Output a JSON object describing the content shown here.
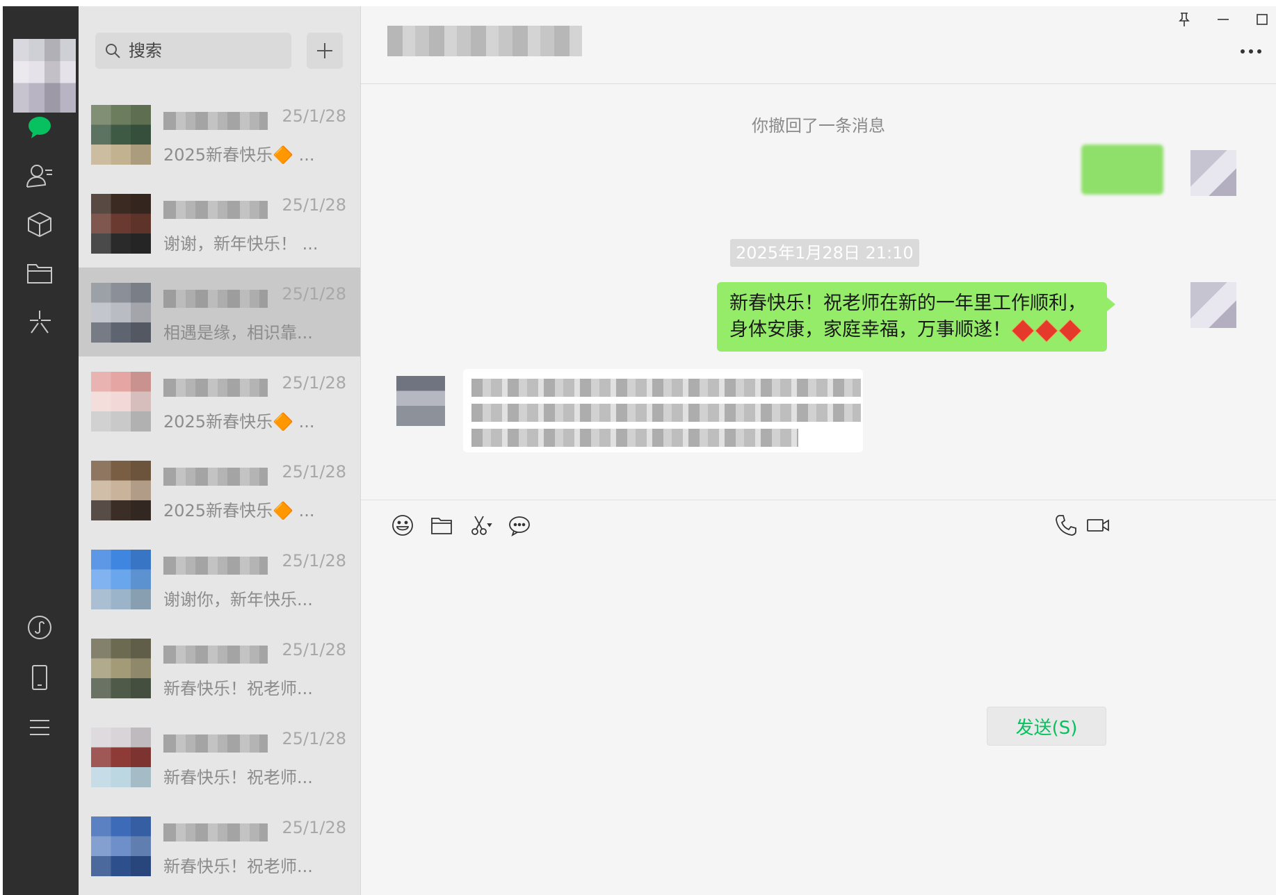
{
  "search": {
    "placeholder": "搜索"
  },
  "sessions": [
    {
      "time": "25/1/28",
      "preview": "2025新春快乐🔶 ...",
      "avatar_colors": [
        "#6b7d5c",
        "#3e5a44",
        "#c3b28f"
      ]
    },
    {
      "time": "25/1/28",
      "preview": "谢谢，新年快乐！ ...",
      "avatar_colors": [
        "#3b2a22",
        "#6a3a30",
        "#2a2a2a"
      ]
    },
    {
      "time": "25/1/28",
      "preview": "相遇是缘，相识靠...",
      "avatar_colors": [
        "#8b9098",
        "#b9bcc3",
        "#5e6470"
      ]
    },
    {
      "time": "25/1/28",
      "preview": "2025新春快乐🔶 ...",
      "avatar_colors": [
        "#e5a6a3",
        "#f2d8d6",
        "#c9c9c9"
      ]
    },
    {
      "time": "25/1/28",
      "preview": "2025新春快乐🔶 ...",
      "avatar_colors": [
        "#7a5e44",
        "#c9b39a",
        "#3a2e26"
      ]
    },
    {
      "time": "25/1/28",
      "preview": "谢谢你，新年快乐...",
      "avatar_colors": [
        "#3f86e0",
        "#6aa6ec",
        "#9bb4c9"
      ]
    },
    {
      "time": "25/1/28",
      "preview": "新春快乐！祝老师...",
      "avatar_colors": [
        "#6d6a52",
        "#a39b78",
        "#4f5a48"
      ]
    },
    {
      "time": "25/1/28",
      "preview": "新春快乐！祝老师...",
      "avatar_colors": [
        "#d9d4d8",
        "#8e3b37",
        "#bcd6e2"
      ]
    },
    {
      "time": "25/1/28",
      "preview": "新春快乐！祝老师...",
      "avatar_colors": [
        "#3e6bb8",
        "#6e8fc9",
        "#2d4f8c"
      ]
    }
  ],
  "chat": {
    "system_message": "你撤回了一条消息",
    "timestamp": "2025年1月28日 21:10",
    "my_message": "新春快乐！祝老师在新的一年里工作顺利，身体安康，家庭幸福，万事顺遂！",
    "send_label": "发送(S)"
  },
  "colors": {
    "nav_bg": "#2e2e2e",
    "accent_green": "#07c160",
    "bubble_green": "#95ec69",
    "list_bg": "#e6e6e6",
    "chat_bg": "#f5f5f5"
  },
  "icons": {
    "nav": [
      "chat-icon",
      "contacts-icon",
      "collections-icon",
      "files-icon",
      "moments-icon",
      "mini-programs-icon",
      "phone-icon",
      "menu-icon"
    ],
    "toolbar": [
      "emoji-icon",
      "folder-icon",
      "scissors-icon",
      "chat-bubble-icon",
      "phone-call-icon",
      "video-call-icon"
    ],
    "window": [
      "pin-icon",
      "minimize-icon",
      "maximize-icon",
      "close-icon",
      "more-icon"
    ]
  }
}
